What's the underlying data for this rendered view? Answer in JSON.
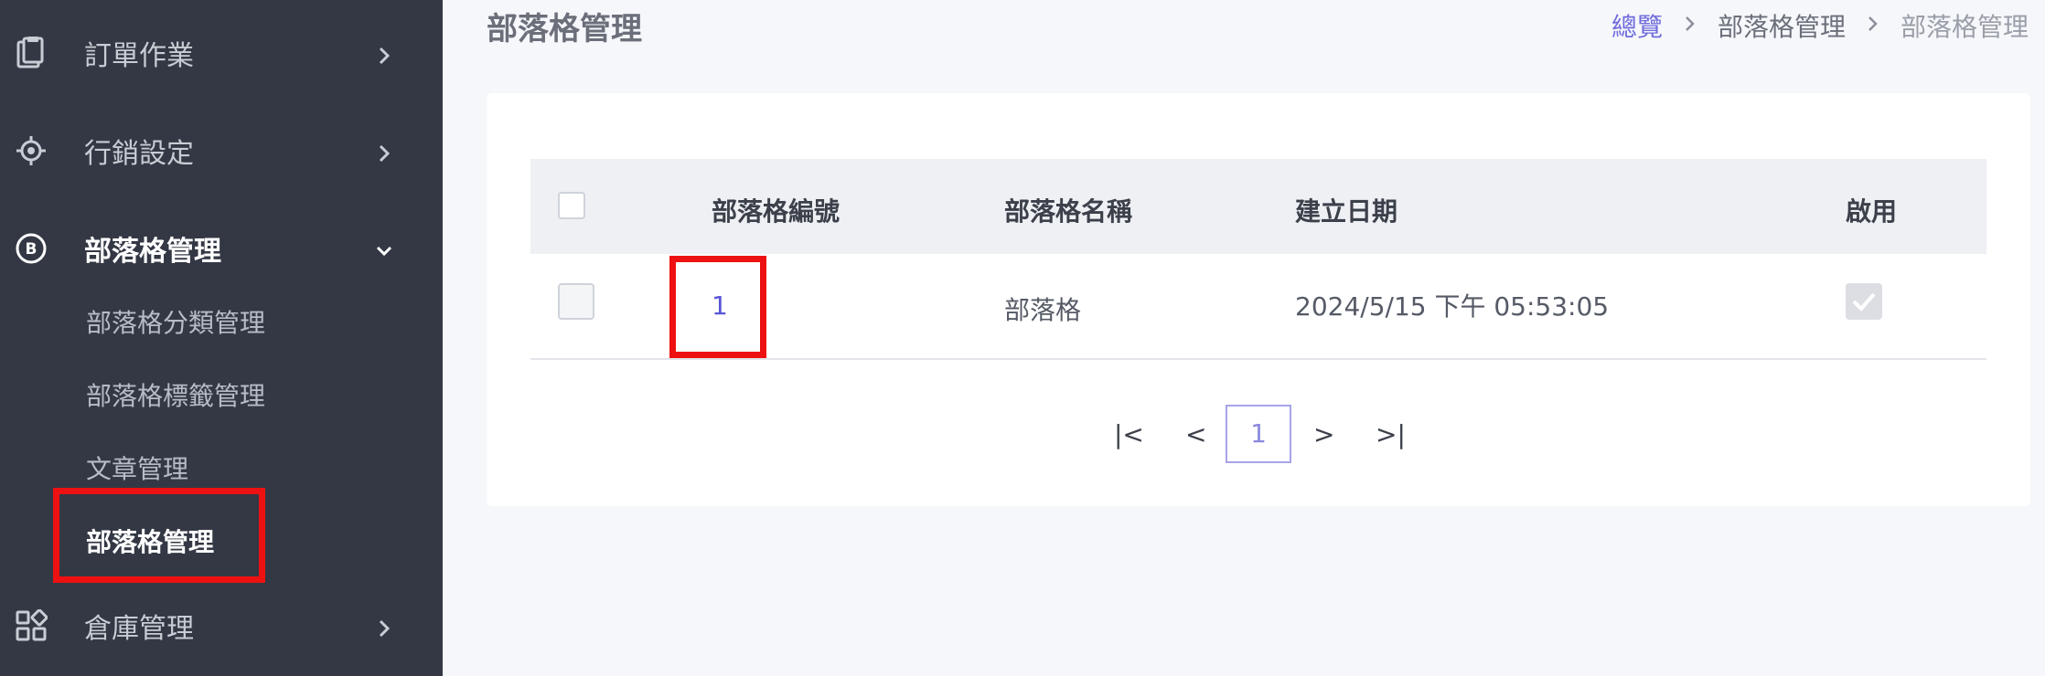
{
  "sidebar": {
    "items": [
      {
        "label": "訂單作業",
        "icon": "clipboard-icon"
      },
      {
        "label": "行銷設定",
        "icon": "target-icon"
      },
      {
        "label": "部落格管理",
        "icon": "blog-b-icon"
      },
      {
        "label": "倉庫管理",
        "icon": "grid-apps-icon"
      }
    ],
    "subitems": [
      {
        "label": "部落格分類管理"
      },
      {
        "label": "部落格標籤管理"
      },
      {
        "label": "文章管理"
      },
      {
        "label": "部落格管理"
      }
    ]
  },
  "header": {
    "title": "部落格管理",
    "breadcrumb": [
      "總覽",
      "部落格管理",
      "部落格管理"
    ]
  },
  "table": {
    "columns": [
      "部落格編號",
      "部落格名稱",
      "建立日期",
      "啟用"
    ],
    "rows": [
      {
        "id": "1",
        "name": "部落格",
        "created": "2024/5/15 下午 05:53:05",
        "enabled": true
      }
    ]
  },
  "pagination": {
    "first": "|<",
    "prev": "<",
    "current": "1",
    "next": ">",
    "last": ">|"
  },
  "colors": {
    "sidebar_bg": "#333844",
    "accent": "#6f6cdc",
    "highlight": "#ee1111"
  }
}
